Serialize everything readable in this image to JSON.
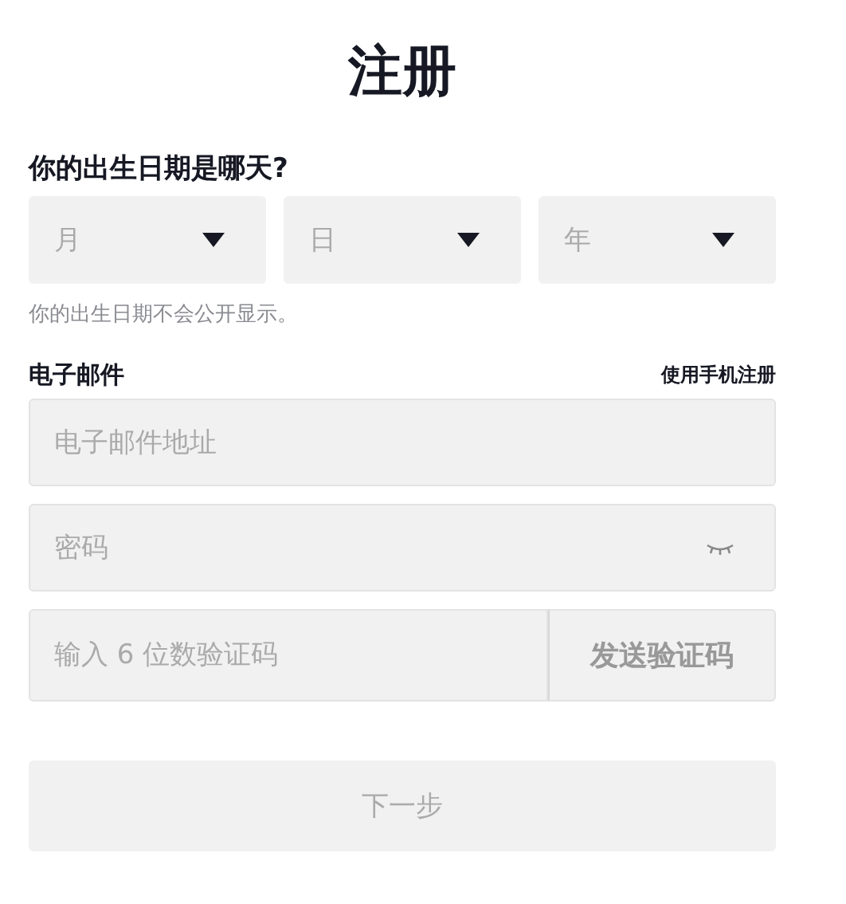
{
  "title": "注册",
  "birthday": {
    "label": "你的出生日期是哪天?",
    "selects": [
      {
        "placeholder": "月"
      },
      {
        "placeholder": "日"
      },
      {
        "placeholder": "年"
      }
    ],
    "hint": "你的出生日期不会公开显示。"
  },
  "email_section": {
    "label": "电子邮件",
    "switch_link": "使用手机注册"
  },
  "fields": [
    {
      "kind": "email",
      "placeholder": "电子邮件地址"
    },
    {
      "kind": "password",
      "placeholder": "密码"
    },
    {
      "kind": "code",
      "placeholder": "输入 6 位数验证码",
      "button": "发送验证码"
    }
  ],
  "next_button": {
    "label": "下一步",
    "disabled": true
  }
}
